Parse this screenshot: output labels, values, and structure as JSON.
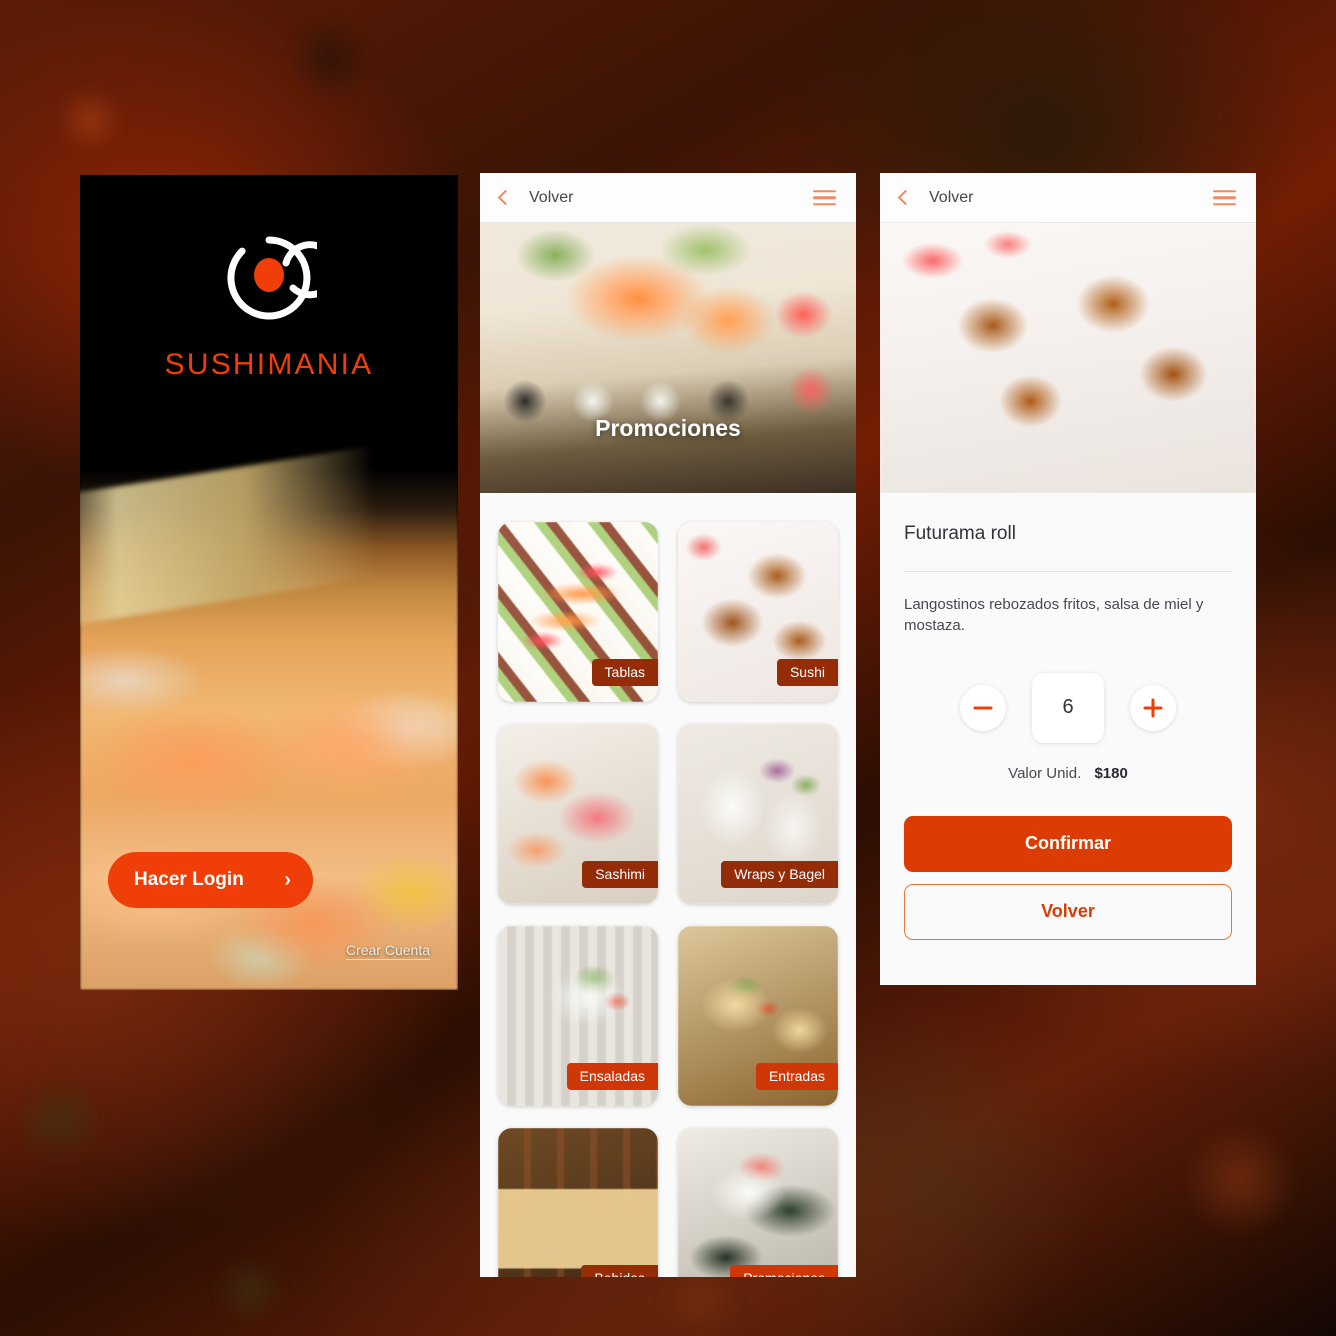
{
  "brand": {
    "name": "SUSHIMANIA",
    "logo_icon": "sushi-spiral-logo",
    "accent": "#e8400c",
    "accent_dark": "#d63c08",
    "badge_dark": "#8f2d0a"
  },
  "login_screen": {
    "cta_label": "Hacer Login",
    "cta_chevron": "›",
    "create_account_label": "Crear Cuenta"
  },
  "catalog_screen": {
    "appbar": {
      "back_label": "Volver",
      "back_icon": "chevron-left-icon",
      "menu_icon": "hamburger-menu-icon"
    },
    "hero": {
      "title": "Promociones",
      "dots": 5,
      "active_dot": 0
    },
    "categories": [
      {
        "label": "Tablas",
        "art": "art-tablas",
        "bright": false
      },
      {
        "label": "Sushi",
        "art": "art-sushi",
        "bright": false
      },
      {
        "label": "Sashimi",
        "art": "art-sashimi",
        "bright": false
      },
      {
        "label": "Wraps y Bagel",
        "art": "art-wraps",
        "bright": false
      },
      {
        "label": "Ensaladas",
        "art": "art-ensaladas",
        "bright": true
      },
      {
        "label": "Entradas",
        "art": "art-entradas",
        "bright": true
      },
      {
        "label": "Bebidas",
        "art": "art-bebidas",
        "bright": false
      },
      {
        "label": "Promociones",
        "art": "art-promos",
        "bright": true
      }
    ]
  },
  "detail_screen": {
    "appbar": {
      "back_label": "Volver",
      "back_icon": "chevron-left-icon",
      "menu_icon": "hamburger-menu-icon"
    },
    "product": {
      "title": "Futurama roll",
      "description": "Langostinos rebozados fritos, salsa de miel y mostaza.",
      "quantity": "6",
      "unit_price_label": "Valor Unid.",
      "unit_price_value": "$180"
    },
    "stepper": {
      "decrement_icon": "minus-icon",
      "increment_icon": "plus-icon"
    },
    "actions": {
      "confirm_label": "Confirmar",
      "back_label": "Volver"
    }
  }
}
